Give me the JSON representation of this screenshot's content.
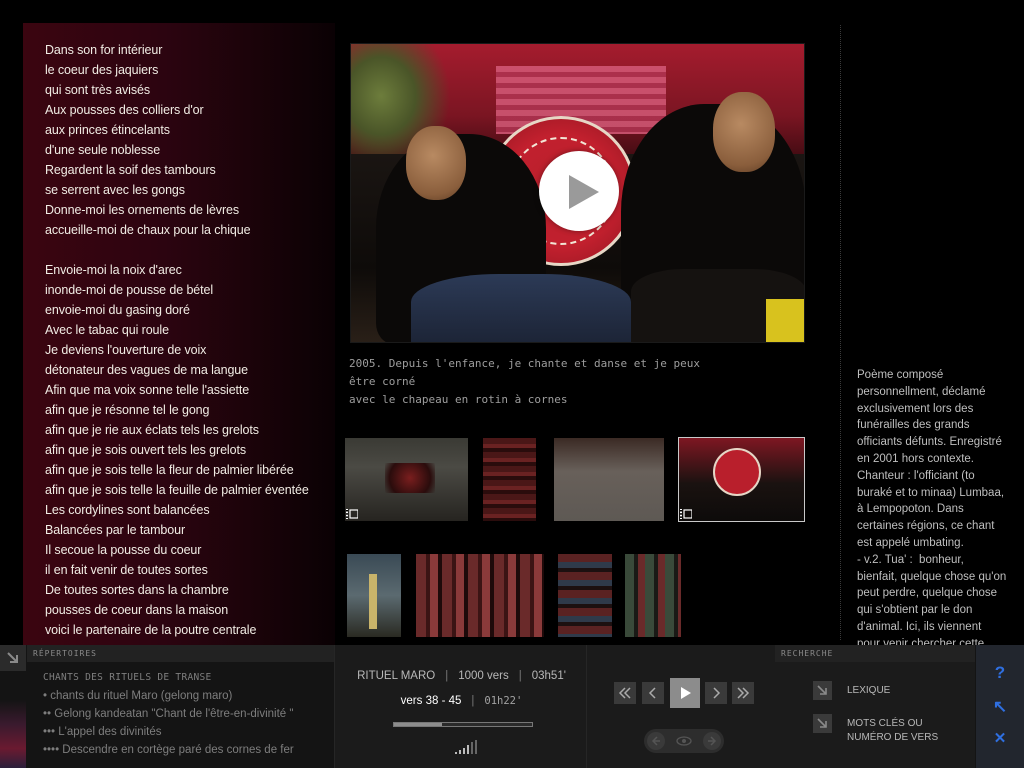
{
  "poem": {
    "lines": [
      "Dans son for intérieur",
      "le coeur des jaquiers",
      "qui sont très avisés",
      "Aux pousses  des colliers d'or",
      "aux princes étincelants",
      "d'une seule noblesse",
      "Regardent  la soif des tambours",
      "se serrent avec les gongs",
      "Donne-moi les ornements de lèvres",
      "accueille-moi de chaux pour la chique",
      "",
      "Envoie-moi la noix d'arec",
      "inonde-moi de pousse de bétel",
      "envoie-moi du gasing doré",
      "Avec le tabac qui roule",
      "Je deviens l'ouverture de voix",
      "détonateur des vagues de ma langue",
      "Afin que ma voix sonne telle l'assiette",
      "afin que je résonne tel le gong",
      "afin que je rie aux éclats tels les grelots",
      "afin que je sois ouvert tels les grelots",
      "afin que je sois telle la fleur de palmier libérée",
      "afin que je sois telle la feuille de palmier éventée",
      "Les cordylines sont balancées",
      "Balancées par le tambour",
      "Il secoue la pousse du coeur",
      "il en fait venir de toutes sortes",
      "De toutes sortes dans la chambre",
      "pousses de coeur dans la maison",
      "voici le partenaire de la poutre centrale"
    ]
  },
  "media": {
    "caption": "2005. Depuis l'enfance, je chante et danse et je peux être corné\navec le chapeau en rotin à cornes",
    "play_icon": "play-icon",
    "film_icon": "film-icon"
  },
  "notes": {
    "text": "Poème composé personnellment, déclamé exclusivement lors des funérailles des grands officiants défunts. Enregistré en 2001 hors contexte. Chanteur : l'officiant (to buraké et to minaa) Lumbaa, à Lempopoton. Dans certaines régions, ce chant est appelé umbating.\n- v.2. Tua' :  bonheur, bienfait, quelque chose qu'on peut perdre, quelque chose qui s'obtient par le don d'animal. Ici, ils viennent pour venir chercher cette"
  },
  "bottom": {
    "repertoires_label": "RÉPERTOIRES",
    "repertoires": [
      "CHANTS DES RITUELS DE TRANSE",
      "• chants du rituel Maro (gelong maro)",
      "•• Gelong kandeatan \"Chant de l'être-en-divinité \"",
      "••• L'appel des divinités",
      "•••• Descendre en cortège paré des cornes de fer"
    ],
    "info": {
      "title": "RITUEL MARO",
      "verses": "1000 vers",
      "duration": "03h51'",
      "range": "vers 38 - 45",
      "elapsed": "01h22'",
      "progress": 0.35
    },
    "transport": {
      "first": "rewind-icon",
      "prev": "previous-icon",
      "play": "play-icon",
      "next": "next-icon",
      "last": "fast-forward-icon"
    },
    "search_label": "RECHERCHE",
    "search_items": [
      "LEXIQUE",
      "MOTS CLÉS OU\nNUMÉRO DE VERS"
    ],
    "tools": {
      "help": "?",
      "back": "↖",
      "close": "✕"
    }
  }
}
